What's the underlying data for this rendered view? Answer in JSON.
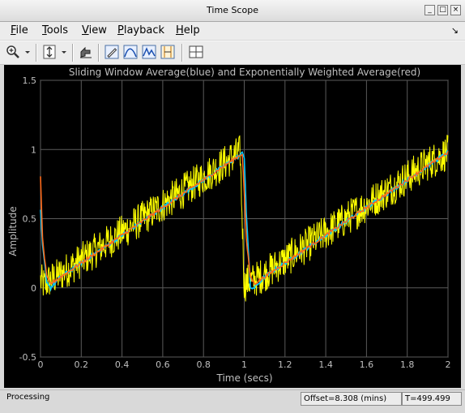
{
  "window": {
    "title": "Time Scope"
  },
  "menu": [
    {
      "label": "File",
      "mnemonic": "F",
      "rest": "ile"
    },
    {
      "label": "Tools",
      "mnemonic": "T",
      "rest": "ools"
    },
    {
      "label": "View",
      "mnemonic": "V",
      "rest": "iew"
    },
    {
      "label": "Playback",
      "mnemonic": "P",
      "rest": "layback"
    },
    {
      "label": "Help",
      "mnemonic": "H",
      "rest": "elp"
    }
  ],
  "toolbar": {
    "icons": [
      "zoom-in-icon",
      "dropdown-arrow-icon",
      "scale-y-icon",
      "dropdown-arrow-icon",
      "restore-view-icon",
      "highlight-icon",
      "signal-stats-icon",
      "peak-finder-icon",
      "cursor-measurements-icon",
      "layout-icon"
    ]
  },
  "chart_data": {
    "type": "line",
    "title": "Sliding Window Average(blue) and Exponentially Weighted Average(red)",
    "xlabel": "Time (secs)",
    "ylabel": "Amplitude",
    "xlim": [
      0,
      2
    ],
    "ylim": [
      -0.5,
      1.5
    ],
    "xticks": [
      "0",
      "0.2",
      "0.4",
      "0.6",
      "0.8",
      "1",
      "1.2",
      "1.4",
      "1.6",
      "1.8",
      "2"
    ],
    "yticks": [
      "-0.5",
      "0",
      "0.5",
      "1",
      "1.5"
    ],
    "grid": true,
    "background": "#000000",
    "series": [
      {
        "color": "#ffff00",
        "noise": 0.13,
        "x": [
          0,
          0.02,
          0.04,
          0.1,
          0.2,
          0.3,
          0.4,
          0.5,
          0.6,
          0.7,
          0.8,
          0.9,
          0.98,
          1.0,
          1.02,
          1.04,
          1.1,
          1.2,
          1.3,
          1.4,
          1.5,
          1.6,
          1.7,
          1.8,
          1.9,
          2.0
        ],
        "values": [
          0.05,
          0.02,
          0.05,
          0.1,
          0.2,
          0.3,
          0.4,
          0.5,
          0.6,
          0.7,
          0.8,
          0.9,
          0.98,
          0.02,
          0.05,
          0.05,
          0.1,
          0.2,
          0.3,
          0.4,
          0.5,
          0.6,
          0.7,
          0.8,
          0.9,
          0.98
        ]
      },
      {
        "color": "#00c8ff",
        "noise": 0.015,
        "x": [
          0,
          0.01,
          0.03,
          0.05,
          0.1,
          0.2,
          0.3,
          0.4,
          0.5,
          0.6,
          0.7,
          0.8,
          0.9,
          0.99,
          1.0,
          1.01,
          1.03,
          1.05,
          1.1,
          1.2,
          1.3,
          1.4,
          1.5,
          1.6,
          1.7,
          1.8,
          1.9,
          2.0
        ],
        "values": [
          0.55,
          0.3,
          0.05,
          0.0,
          0.08,
          0.18,
          0.28,
          0.38,
          0.48,
          0.58,
          0.68,
          0.78,
          0.88,
          0.97,
          0.95,
          0.55,
          0.0,
          0.0,
          0.08,
          0.18,
          0.28,
          0.38,
          0.48,
          0.58,
          0.68,
          0.78,
          0.88,
          0.98
        ]
      },
      {
        "color": "#ff6a1a",
        "noise": 0.012,
        "x": [
          0,
          0.01,
          0.03,
          0.05,
          0.1,
          0.2,
          0.3,
          0.4,
          0.5,
          0.6,
          0.7,
          0.8,
          0.9,
          0.99,
          1.0,
          1.01,
          1.03,
          1.05,
          1.1,
          1.2,
          1.3,
          1.4,
          1.5,
          1.6,
          1.7,
          1.8,
          1.9,
          2.0
        ],
        "values": [
          0.8,
          0.35,
          0.08,
          0.03,
          0.08,
          0.18,
          0.28,
          0.38,
          0.48,
          0.58,
          0.68,
          0.78,
          0.88,
          0.97,
          0.7,
          0.35,
          0.08,
          0.03,
          0.08,
          0.18,
          0.28,
          0.38,
          0.48,
          0.58,
          0.68,
          0.78,
          0.88,
          0.98
        ]
      }
    ]
  },
  "status": {
    "left": "Processing",
    "offset": "Offset=8.308 (mins)",
    "time": "T=499.499"
  }
}
